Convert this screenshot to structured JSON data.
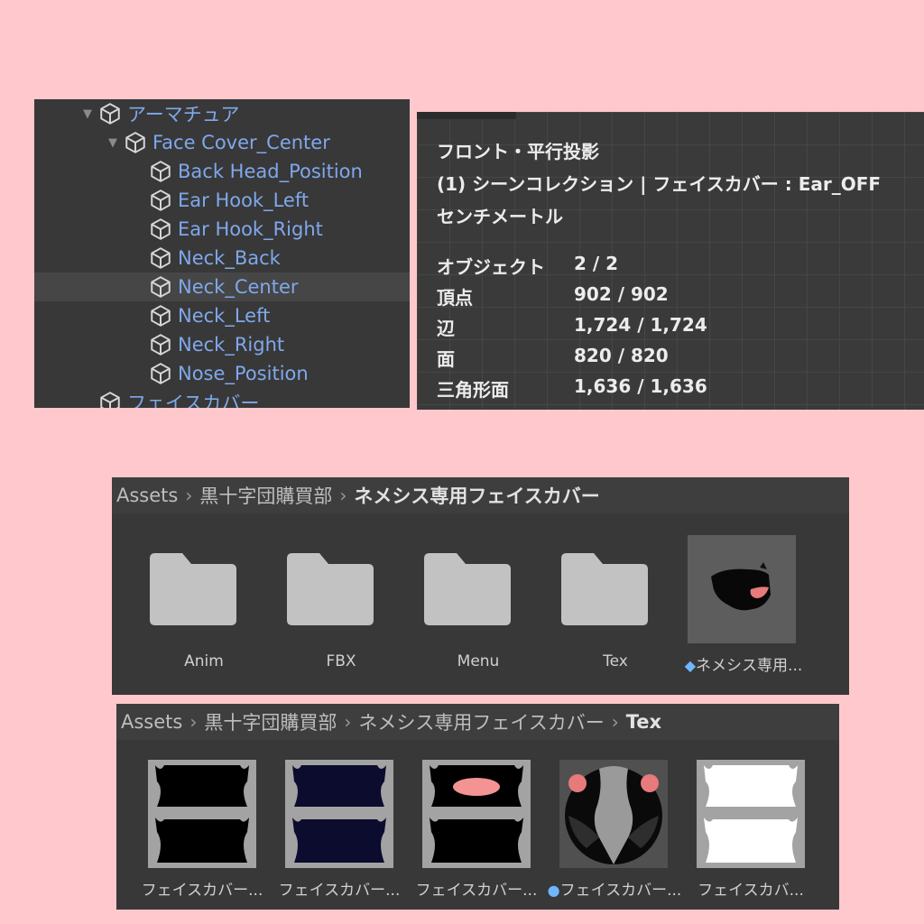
{
  "hierarchy": {
    "items": [
      {
        "label": "アーマチュア"
      },
      {
        "label": "Face Cover_Center"
      },
      {
        "label": "Back Head_Position"
      },
      {
        "label": "Ear Hook_Left"
      },
      {
        "label": "Ear Hook_Right"
      },
      {
        "label": "Neck_Back"
      },
      {
        "label": "Neck_Center"
      },
      {
        "label": "Neck_Left"
      },
      {
        "label": "Neck_Right"
      },
      {
        "label": "Nose_Position"
      },
      {
        "label": "フェイスカバー"
      }
    ],
    "selected_index": 6
  },
  "stats": {
    "view": "フロント・平行投影",
    "collection": "(1) シーンコレクション | フェイスカバー : Ear_OFF",
    "units": "センチメートル",
    "rows": [
      {
        "key": "オブジェクト",
        "value": "2 / 2"
      },
      {
        "key": "頂点",
        "value": "902 / 902"
      },
      {
        "key": "辺",
        "value": "1,724 / 1,724"
      },
      {
        "key": "面",
        "value": "820 / 820"
      },
      {
        "key": "三角形面",
        "value": "1,636 / 1,636"
      }
    ]
  },
  "project1": {
    "breadcrumb": [
      "Assets",
      "黒十字団購買部",
      "ネメシス専用フェイスカバー"
    ],
    "items": [
      {
        "label": "Anim",
        "kind": "folder"
      },
      {
        "label": "FBX",
        "kind": "folder"
      },
      {
        "label": "Menu",
        "kind": "folder"
      },
      {
        "label": "Tex",
        "kind": "folder"
      },
      {
        "label": "ネメシス専用...",
        "kind": "prefab"
      }
    ]
  },
  "project2": {
    "breadcrumb": [
      "Assets",
      "黒十字団購買部",
      "ネメシス専用フェイスカバー",
      "Tex"
    ],
    "items": [
      {
        "label": "フェイスカバー...",
        "kind": "texture",
        "color": "#000000"
      },
      {
        "label": "フェイスカバー...",
        "kind": "texture",
        "color": "#0c0c2e"
      },
      {
        "label": "フェイスカバー...",
        "kind": "texture",
        "color": "#000000"
      },
      {
        "label": "フェイスカバー...",
        "kind": "material"
      },
      {
        "label": "フェイスカバ...",
        "kind": "texture",
        "color": "#ffffff"
      }
    ]
  },
  "colors": {
    "background": "#ffc8cc",
    "panel": "#383838",
    "link": "#7fa8ec",
    "folder": "#c2c2c2"
  }
}
